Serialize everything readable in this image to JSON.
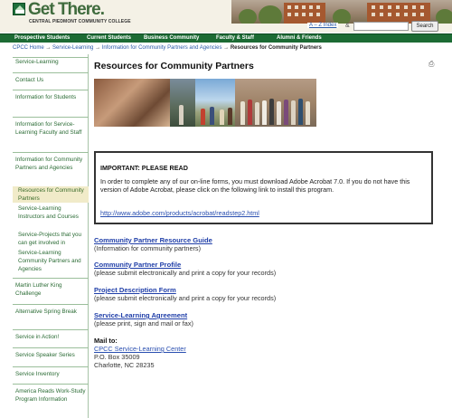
{
  "header": {
    "logo_text": "Get There.",
    "logo_sub": "CENTRAL PIEDMONT COMMUNITY COLLEGE",
    "az_index": "A – Z Index",
    "search_button": "Search",
    "search_placeholder": ""
  },
  "topnav": [
    {
      "label": "Prospective Students"
    },
    {
      "label": "Current Students"
    },
    {
      "label": "Business Community"
    },
    {
      "label": "Faculty & Staff"
    },
    {
      "label": "Alumni & Friends"
    }
  ],
  "breadcrumb": {
    "home": "CPCC Home",
    "sep": "→",
    "level1": "Service-Learning",
    "level2": "Information for Community Partners and Agencies",
    "current": "Resources for Community Partners"
  },
  "sidebar": [
    {
      "label": "Service-Learning"
    },
    {
      "label": "Contact Us"
    },
    {
      "label": "Information for Students"
    },
    {
      "label": "Information for Service-Learning Faculty and Staff"
    },
    {
      "label": "Information for Community Partners and Agencies"
    },
    {
      "label": "Resources for Community Partners"
    },
    {
      "label": "Service-Learning Instructors and Courses"
    },
    {
      "label": "Service-Projects that you can get involved in"
    },
    {
      "label": "Service-Learning Community Partners and Agencies"
    },
    {
      "label": "Martin Luther King Challenge"
    },
    {
      "label": "Alternative Spring Break"
    },
    {
      "label": "Service in Action!"
    },
    {
      "label": "Service Speaker Series"
    },
    {
      "label": "Service Inventory"
    },
    {
      "label": "America Reads Work-Study Program Information"
    }
  ],
  "main": {
    "title": "Resources for Community Partners",
    "important": {
      "heading": "IMPORTANT: PLEASE READ",
      "text": "In order to complete any of our on-line forms, you must download Adobe Acrobat 7.0. If you do not have this version of Adobe Acrobat, please click on the following link to install this program.",
      "link": "http://www.adobe.com/products/acrobat/readstep2.html"
    },
    "resources": [
      {
        "link": "Community Partner Resource Guide",
        "note": "(Information for community partners)"
      },
      {
        "link": "Community Partner Profile",
        "note": "(please submit electronically and print a copy for your records)"
      },
      {
        "link": "Project Description Form",
        "note": "(please submit electronically and print a copy for your records)"
      },
      {
        "link": "Service-Learning Agreement",
        "note": "(please print, sign and mail or fax)"
      }
    ],
    "mail": {
      "label": "Mail to:",
      "center": "CPCC Service-Learning Center",
      "box": "P.O. Box 35009",
      "city": "Charlotte, NC 28235"
    }
  },
  "colors": {
    "brand_green": "#1c6b34",
    "link_blue": "#1f3ea8",
    "active_bg": "#f1ebc9"
  }
}
